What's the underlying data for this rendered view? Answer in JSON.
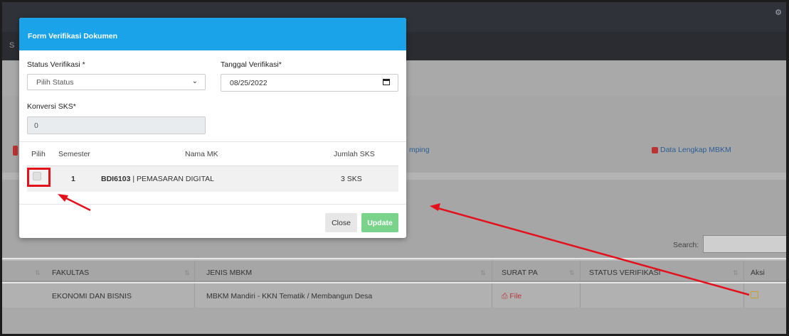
{
  "background": {
    "subbar_letter": "S",
    "pending_link": "mping",
    "data_link": "Data Lengkap MBKM",
    "search_label": "Search:",
    "table": {
      "headers": {
        "fakultas": "FAKULTAS",
        "jenis": "JENIS MBKM",
        "surat": "SURAT PA",
        "status": "STATUS VERIFIKASI",
        "aksi": "Aksi"
      },
      "row": {
        "fakultas": "EKONOMI DAN BISNIS",
        "jenis": "MBKM Mandiri - KKN Tematik / Membangun Desa",
        "surat": "File",
        "status": ""
      }
    }
  },
  "modal": {
    "title": "Form Verifikasi Dokumen",
    "status_label": "Status Verifikasi *",
    "status_value": "Pilih Status",
    "tanggal_label": "Tanggal Verifikasi*",
    "tanggal_value": "08/25/2022",
    "sks_label": "Konversi SKS*",
    "sks_value": "0",
    "table": {
      "headers": {
        "pilih": "Pilih",
        "semester": "Semester",
        "nama_mk": "Nama MK",
        "jumlah_sks": "Jumlah SKS"
      },
      "rows": [
        {
          "semester": "1",
          "kode": "BDI6103",
          "nama": "| PEMASARAN DIGITAL",
          "sks": "3 SKS"
        }
      ]
    },
    "close_label": "Close",
    "update_label": "Update"
  },
  "colors": {
    "modal_header": "#1aa3e8",
    "update_button": "#79d38b",
    "annotation": "#e3111b"
  },
  "icons": [
    "gear-icon",
    "chevron-down-icon",
    "calendar-icon",
    "print-icon",
    "edit-icon"
  ]
}
